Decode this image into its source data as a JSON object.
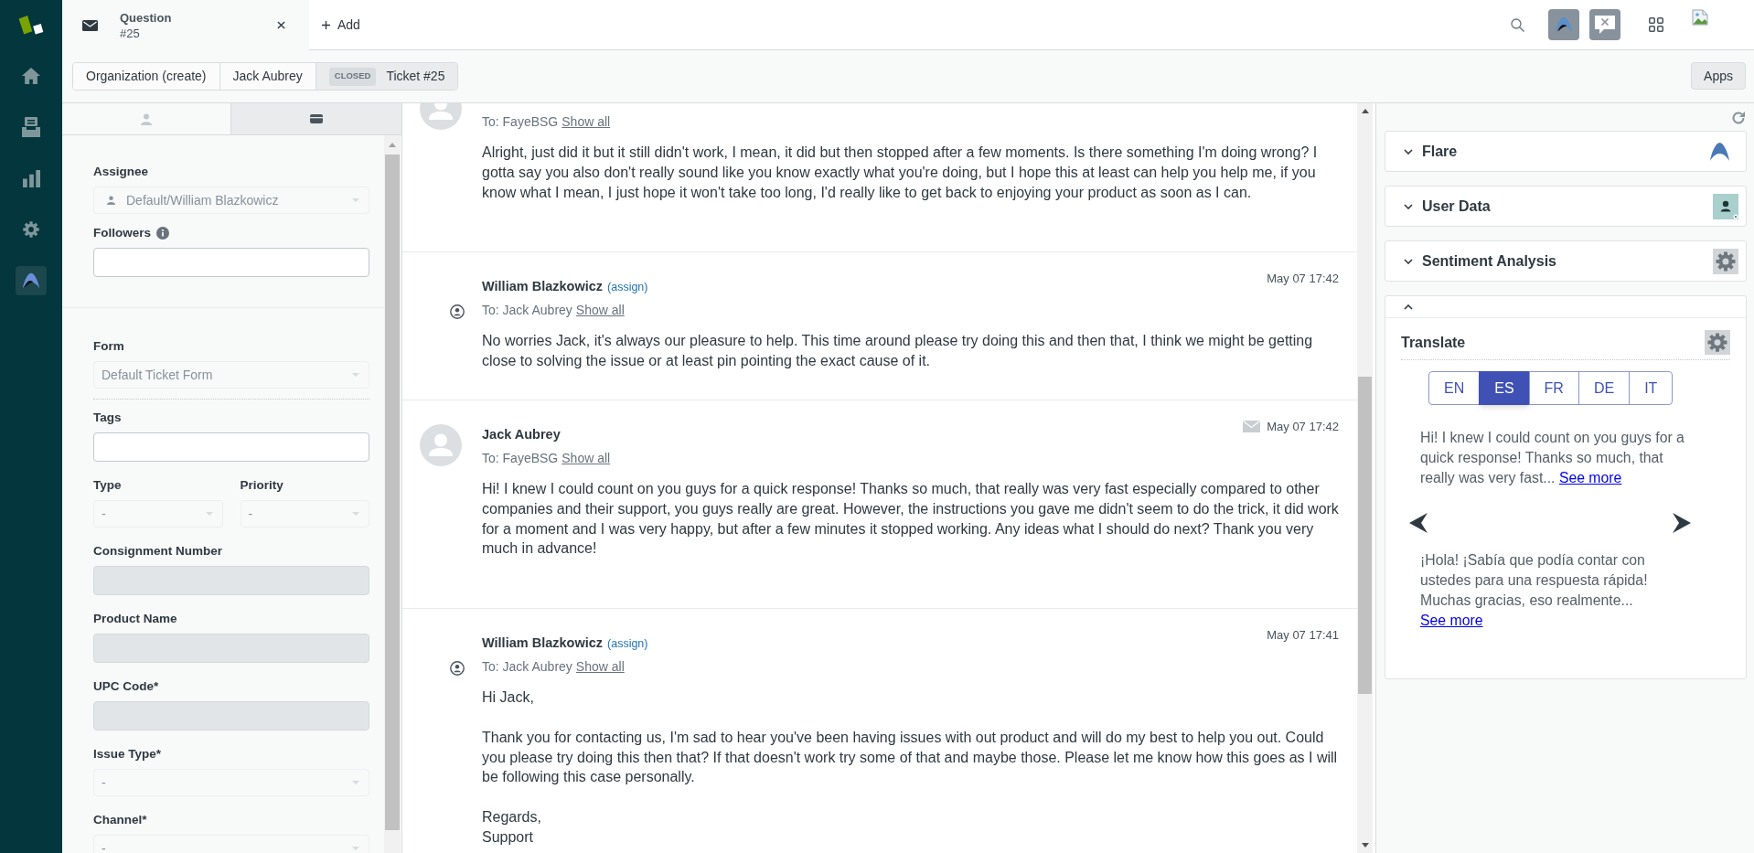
{
  "nav": {
    "items": [
      {
        "selected": false
      },
      {
        "selected": false
      },
      {
        "selected": false
      },
      {
        "selected": false
      },
      {
        "selected": true
      }
    ]
  },
  "tabs": [
    {
      "title": "Question",
      "subtitle": "#25",
      "selected": true
    }
  ],
  "add_tab": "Add",
  "breadcrumb": [
    {
      "label": "Organization (create)",
      "selected": false
    },
    {
      "label": "Jack Aubrey",
      "selected": false
    },
    {
      "badge": "CLOSED",
      "label": "Ticket #25",
      "selected": true
    }
  ],
  "apps_button": "Apps",
  "sidebar": {
    "tabs": [
      {
        "selected": false
      },
      {
        "selected": true
      }
    ],
    "sections": [
      {
        "fields": [
          {
            "kind": "assignee",
            "label": "Assignee",
            "value": "Default/William Blazkowicz",
            "disabled": true
          },
          {
            "kind": "input",
            "label": "Followers",
            "info": true,
            "disabled": false
          }
        ]
      },
      {
        "fields": [
          {
            "kind": "select",
            "label": "Form",
            "value": "Default Ticket Form",
            "disabled": true
          }
        ]
      },
      {
        "fields": [
          {
            "kind": "input",
            "label": "Tags",
            "disabled": false
          },
          {
            "kind": "pair",
            "fields": [
              {
                "kind": "select",
                "label": "Type",
                "value": "-",
                "disabled": true
              },
              {
                "kind": "select",
                "label": "Priority",
                "value": "-",
                "disabled": true
              }
            ]
          },
          {
            "kind": "input",
            "label": "Consignment Number",
            "disabled": true
          },
          {
            "kind": "input",
            "label": "Product Name",
            "disabled": true
          },
          {
            "kind": "input",
            "label": "UPC Code*",
            "disabled": true
          },
          {
            "kind": "select",
            "label": "Issue Type*",
            "value": "-",
            "disabled": true
          },
          {
            "kind": "select",
            "label": "Channel*",
            "value": "-",
            "disabled": true
          }
        ]
      }
    ]
  },
  "conversation": {
    "messages": [
      {
        "kind": "customer",
        "to": "To: FayeBSG",
        "show_all": "Show all",
        "body": [
          "Alright, just did it but it still didn't work, I mean, it did but then stopped after a few moments. Is there something I'm doing wrong? I gotta say you also don't really sound like you know exactly what you're doing, but I hope this at least can help you help me, if you know what I mean, I just hope it won't take too long, I'd really like to get back to enjoying your product as soon as I can."
        ]
      },
      {
        "kind": "agent",
        "author": "William Blazkowicz",
        "assign": "(assign)",
        "time": "May 07 17:42",
        "to": "To: Jack Aubrey",
        "show_all": "Show all",
        "body": [
          "No worries Jack, it's always our pleasure to help. This time around please try doing this and then that, I think we might be getting close to solving the issue or at least pin pointing the exact cause of it."
        ]
      },
      {
        "kind": "customer",
        "author": "Jack Aubrey",
        "via_email": true,
        "time": "May 07 17:42",
        "to": "To: FayeBSG",
        "show_all": "Show all",
        "body": [
          "Hi! I knew I could count on you guys for a quick response! Thanks so much, that really was very fast especially compared to other companies and their support, you guys really are great. However, the instructions you gave me didn't seem to do the trick, it did work for a moment and I was very happy, but after a few minutes it stopped working. Any ideas what I should do next? Thank you very much in advance!"
        ]
      },
      {
        "kind": "agent",
        "author": "William Blazkowicz",
        "assign": "(assign)",
        "time": "May 07 17:41",
        "to": "To: Jack Aubrey",
        "show_all": "Show all",
        "body": [
          "Hi Jack,",
          "Thank you for contacting us, I'm sad to hear you've been having issues with out product and will do my best to help you out. Could you please try doing this then that? If that doesn't work try some of that and maybe those. Please let me know how this goes as I will be following this case personally.",
          "Regards,\nSupport"
        ]
      }
    ]
  },
  "apps_panel": {
    "cards": [
      {
        "title": "Flare",
        "expanded": false
      },
      {
        "title": "User Data",
        "expanded": false
      },
      {
        "title": "Sentiment Analysis",
        "expanded": false
      },
      {
        "expanded": true,
        "translate": {
          "title": "Translate",
          "languages": [
            {
              "label": "EN",
              "selected": false
            },
            {
              "label": "ES",
              "selected": true
            },
            {
              "label": "FR",
              "selected": false
            },
            {
              "label": "DE",
              "selected": false
            },
            {
              "label": "IT",
              "selected": false
            }
          ],
          "original": {
            "text": "Hi! I knew I could count on you guys for a quick response! Thanks so much, that really was very fast...",
            "link": "See more"
          },
          "translation": {
            "text": "¡Hola! ¡Sabía que podía contar con ustedes para una respuesta rápida! Muchas gracias, eso realmente...",
            "link": "See more"
          }
        }
      }
    ]
  }
}
